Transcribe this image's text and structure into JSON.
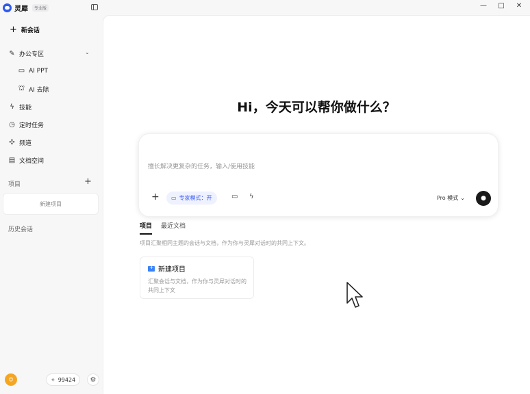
{
  "app": {
    "name": "灵犀",
    "badge": "专业版"
  },
  "window_controls": [
    "—",
    "□",
    "✕"
  ],
  "sidebar": {
    "new_chat": "新会话",
    "items": [
      {
        "label": "办公专区",
        "icon": "pencil-icon"
      },
      {
        "label": "AI PPT",
        "icon": "presentation-icon"
      },
      {
        "label": "AI 去除",
        "icon": "image-edit-icon"
      },
      {
        "label": "技能",
        "icon": "skill-icon"
      },
      {
        "label": "定时任务",
        "icon": "clock-icon"
      },
      {
        "label": "频道",
        "icon": "channel-icon"
      },
      {
        "label": "文档空间",
        "icon": "document-icon"
      }
    ],
    "projects_label": "项目",
    "new_project_placeholder": "新建项目",
    "history_label": "历史会话",
    "points": "99424"
  },
  "main": {
    "headline": "Hi，今天可以帮你做什么？",
    "input_placeholder": "擅长解决更复杂的任务，输入/使用技能",
    "expert_mode_label": "专家模式：开",
    "pro_mode_label": "Pro 模式",
    "tabs": [
      {
        "label": "项目",
        "active": true
      },
      {
        "label": "最近文档",
        "active": false
      }
    ],
    "tab_description": "项目汇聚相同主题的会话与文档，作为你与灵犀对话时的共同上下文。",
    "new_project_card": {
      "title": "新建项目",
      "description": "汇聚会话与文档，作为你与灵犀对话时的共同上下文"
    }
  },
  "colors": {
    "accent": "#3b5cf5",
    "logo": "#2f5bea",
    "avatar": "#f4a623"
  }
}
